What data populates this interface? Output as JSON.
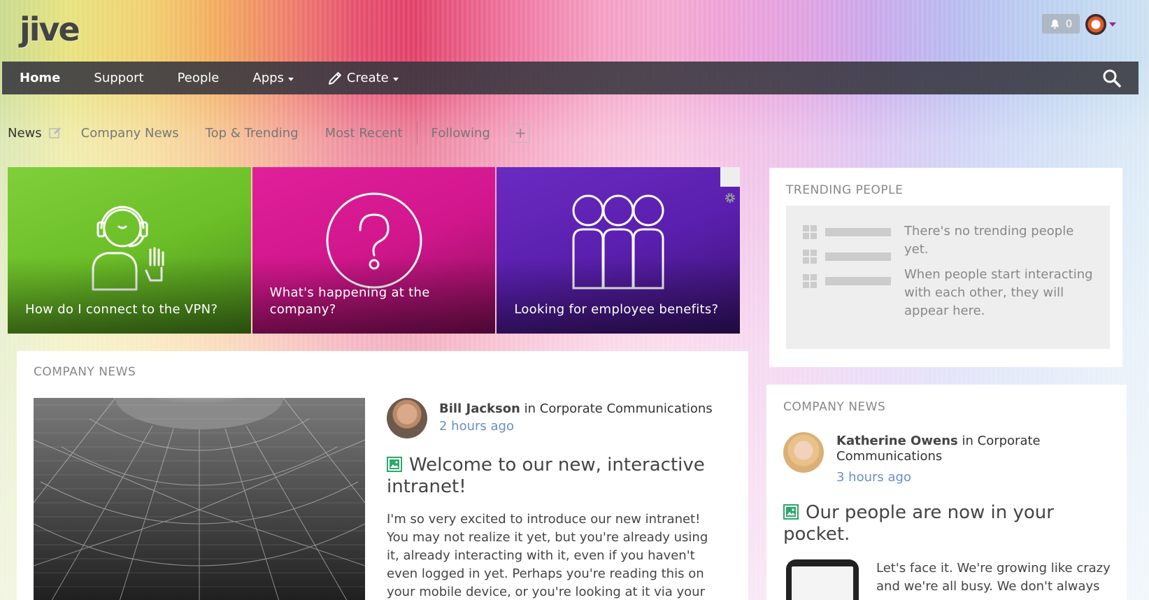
{
  "header": {
    "logo_text": "jive",
    "notifications_count": "0"
  },
  "nav": {
    "items": [
      {
        "label": "Home",
        "active": true
      },
      {
        "label": "Support"
      },
      {
        "label": "People"
      },
      {
        "label": "Apps",
        "dropdown": true
      },
      {
        "label": "Create",
        "dropdown": true,
        "icon": "pencil-icon"
      }
    ],
    "search_icon": "search-icon"
  },
  "tabs": {
    "current": "News",
    "items": [
      "Company News",
      "Top & Trending",
      "Most Recent",
      "Following"
    ],
    "add_label": "+"
  },
  "tiles": [
    {
      "label": "How do I connect to the VPN?",
      "icon": "headset-person-icon",
      "color": "#6cbf28"
    },
    {
      "label": "What's happening at the company?",
      "icon": "question-circle-icon",
      "color": "#d1168c"
    },
    {
      "label": "Looking for employee benefits?",
      "icon": "group-people-icon",
      "color": "#5a1fae"
    }
  ],
  "trending": {
    "title": "TRENDING PEOPLE",
    "empty_line1": "There's no trending people yet.",
    "empty_line2": "When people start interacting with each other, they will appear here."
  },
  "company_news_main": {
    "title": "COMPANY NEWS",
    "author": "Bill Jackson",
    "in_text": "in",
    "place": "Corporate Communications",
    "time": "2 hours ago",
    "post_title": "Welcome to our new, interactive intranet!",
    "post_body": "I'm so very excited to introduce our new intranet! You may not realize it yet, but you're already using it, already interacting with it, even if you haven't even logged in yet. Perhaps you're reading this on your mobile device, or you're looking at it via your email"
  },
  "company_news_side": {
    "title": "COMPANY NEWS",
    "author": "Katherine Owens",
    "in_text": "in",
    "place": "Corporate Communications",
    "time": "3 hours ago",
    "post_title": "Our people are now in your pocket.",
    "post_body": "Let's face it. We're growing like crazy and we're all busy. We don't always"
  },
  "colors": {
    "nav_bg": "#36363e",
    "link_blue": "#6a8dc8",
    "doc_icon_green": "#2ba86a"
  }
}
